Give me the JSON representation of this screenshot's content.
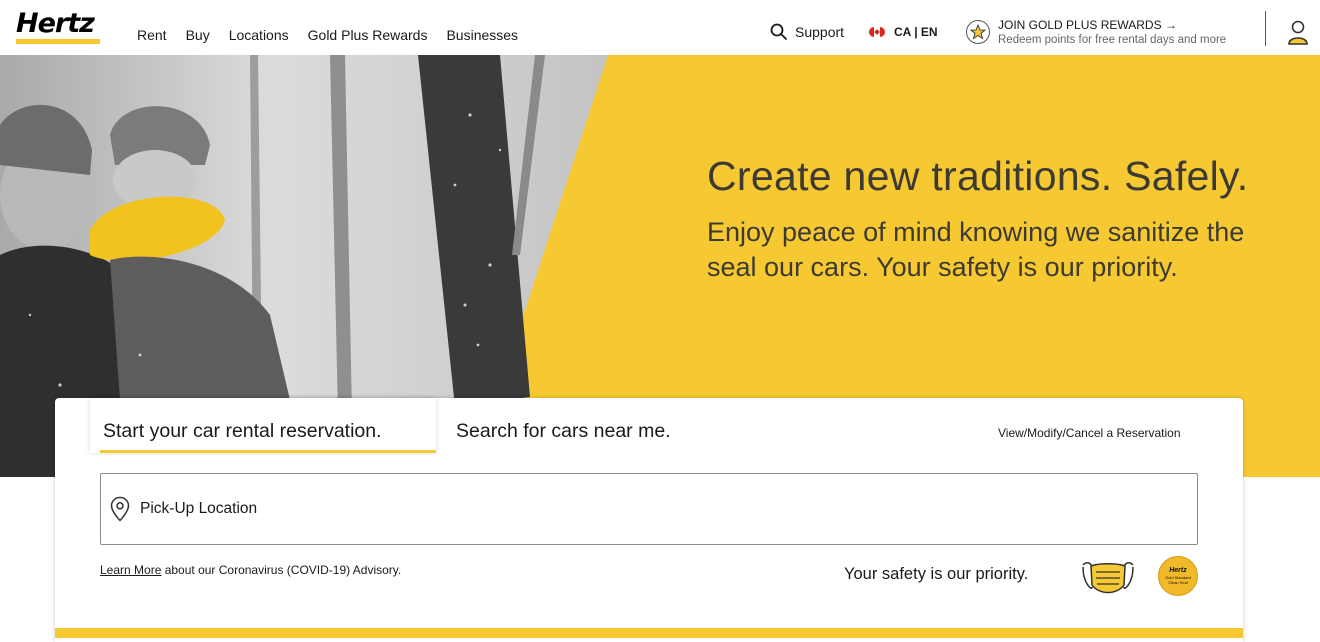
{
  "brand": {
    "logo_text": "Hertz",
    "accent_color": "#f6c932"
  },
  "nav": {
    "items": [
      "Rent",
      "Buy",
      "Locations",
      "Gold Plus Rewards",
      "Businesses"
    ]
  },
  "header": {
    "support_label": "Support",
    "locale_label": "CA | EN",
    "join_title": "JOIN GOLD PLUS REWARDS →",
    "join_subtitle": "Redeem points for free rental days and more",
    "icons": {
      "search": "search-icon",
      "flag": "canada-flag-icon",
      "star": "star-icon",
      "user": "user-icon"
    }
  },
  "hero": {
    "headline": "Create new traditions. Safely.",
    "subline_1": "Enjoy peace of mind knowing we sanitize the",
    "subline_2": "seal our cars. Your safety is our priority."
  },
  "reservation": {
    "tab_active": "Start your car rental reservation.",
    "tab_secondary": "Search for cars near me.",
    "manage_link": "View/Modify/Cancel a Reservation",
    "pickup_placeholder": "Pick-Up Location",
    "learn_more": "Learn More",
    "advisory_text": " about our Coronavirus (COVID-19) Advisory.",
    "safety_text": "Your safety is our priority.",
    "seal_title": "Hertz",
    "seal_text": "Gold Standard Clean Seal"
  }
}
